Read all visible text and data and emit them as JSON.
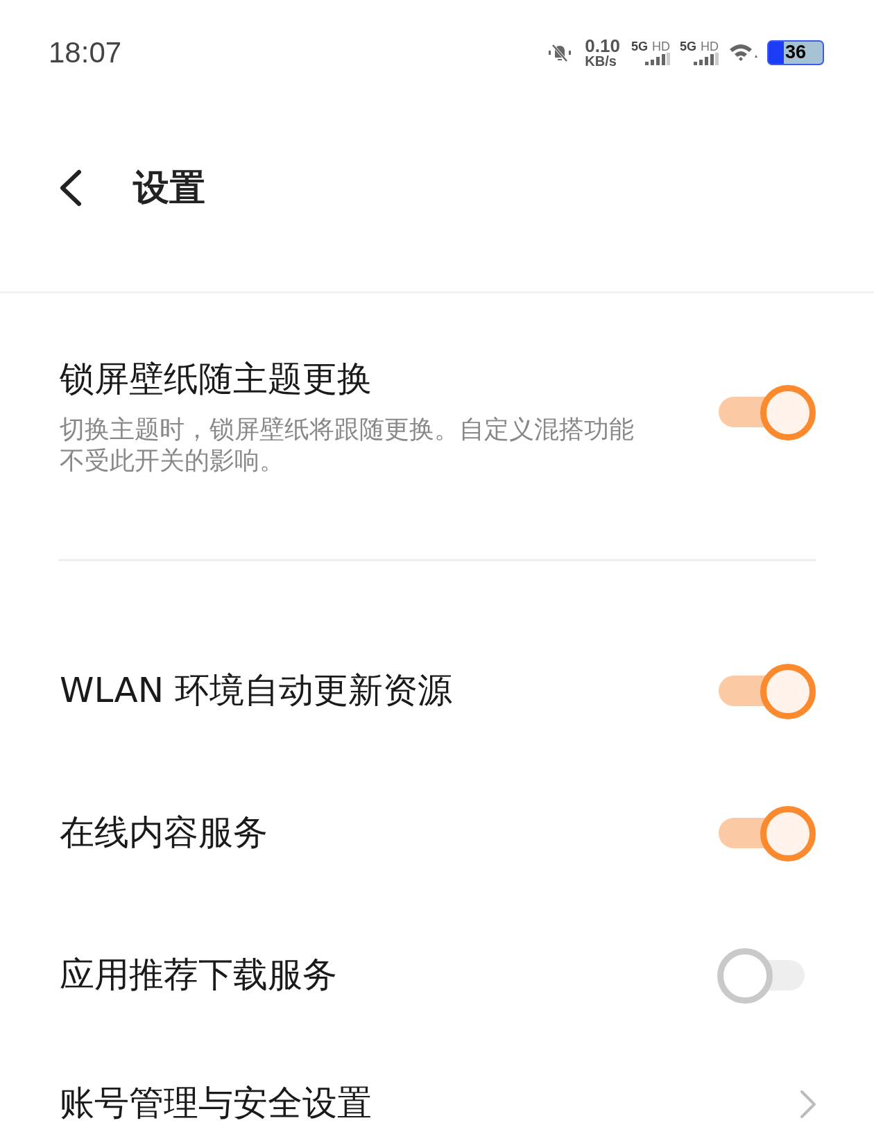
{
  "status_bar": {
    "time": "18:07",
    "speed_value": "0.10",
    "speed_unit": "KB/s",
    "sim_slots": [
      {
        "network": "5G",
        "hd": "HD"
      },
      {
        "network": "5G",
        "hd": "HD"
      }
    ],
    "battery": "36"
  },
  "header": {
    "title": "设置"
  },
  "items": [
    {
      "kind": "toggle",
      "title": "锁屏壁纸随主题更换",
      "description": "切换主题时，锁屏壁纸将跟随更换。自定义混搭功能不受此开关的影响。",
      "on": true,
      "divider": true
    },
    {
      "kind": "toggle",
      "title": "WLAN 环境自动更新资源",
      "on": true
    },
    {
      "kind": "toggle",
      "title": "在线内容服务",
      "on": true
    },
    {
      "kind": "toggle",
      "title": "应用推荐下载服务",
      "on": false
    },
    {
      "kind": "link",
      "title": "账号管理与安全设置"
    }
  ]
}
